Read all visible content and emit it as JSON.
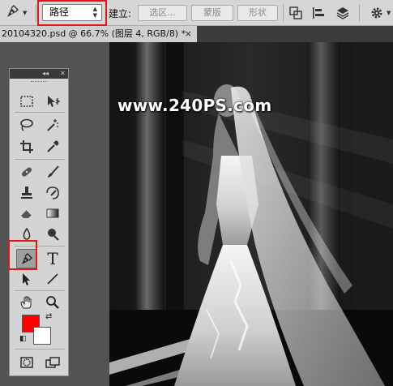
{
  "options_bar": {
    "tool_icon": "pen-icon",
    "mode_value": "路径",
    "build_label": "建立:",
    "buttons": [
      "选区...",
      "蒙版",
      "形状"
    ],
    "icons": [
      "path-operations-icon",
      "path-alignment-icon",
      "path-arrangement-icon",
      "gear-icon"
    ]
  },
  "document_tab": {
    "title": "20104320.psd @ 66.7% (图层 4, RGB/8) *",
    "close": "×"
  },
  "canvas": {
    "watermark": "www.240PS.com",
    "image_description_icon": "bride-photo"
  },
  "toolbox": {
    "header_collapse": "◂◂",
    "header_close": "✕",
    "active_tool": "pen-tool",
    "type_tool_glyph": "T",
    "foreground_color": "#ff0000",
    "background_color": "#ffffff"
  },
  "colors": {
    "highlight": "#e41515",
    "options_bar_bg": "#d6d6d6",
    "workspace_bg": "#535353"
  }
}
